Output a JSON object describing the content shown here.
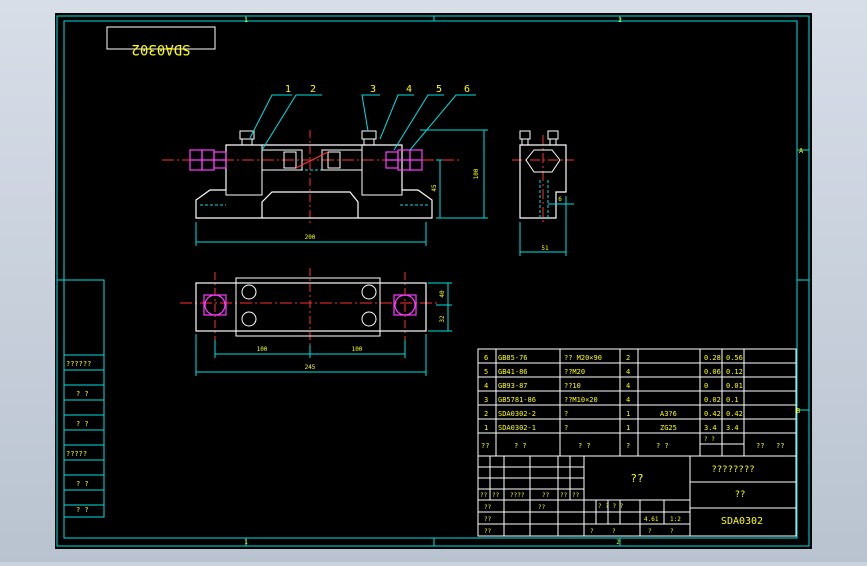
{
  "drawing": {
    "number_mirrored": "SDA0302",
    "number": "SDA0302",
    "grid_top": [
      "1",
      "2"
    ],
    "grid_bottom": [
      "1",
      "2"
    ],
    "grid_side": [
      "A",
      "B"
    ],
    "balloons": [
      "1",
      "2",
      "3",
      "4",
      "5",
      "6"
    ],
    "dims": {
      "front_width": "200",
      "front_height": "100",
      "front_mid": "45",
      "side_width": "51",
      "side_small": "6",
      "top_half_left": "100",
      "top_half_right": "100",
      "top_total": "245",
      "top_h1": "40",
      "top_h2": "32"
    }
  },
  "bom": {
    "rows": [
      {
        "no": "6",
        "code": "GB85-76",
        "name": "?? M20×90",
        "qty": "2",
        "mat": "",
        "w1": "0.28",
        "w2": "0.56"
      },
      {
        "no": "5",
        "code": "GB41-86",
        "name": "??M20",
        "qty": "4",
        "mat": "",
        "w1": "0.06",
        "w2": "0.12"
      },
      {
        "no": "4",
        "code": "GB93-87",
        "name": "??10",
        "qty": "4",
        "mat": "",
        "w1": "0",
        "w2": "0.01"
      },
      {
        "no": "3",
        "code": "GB5781-86",
        "name": "??M10×20",
        "qty": "4",
        "mat": "",
        "w1": "0.02",
        "w2": "0.1"
      },
      {
        "no": "2",
        "code": "SDA0302-2",
        "name": "?",
        "qty": "1",
        "mat": "A3?6",
        "w1": "0.42",
        "w2": "0.42"
      },
      {
        "no": "1",
        "code": "SDA0302-1",
        "name": "?",
        "qty": "1",
        "mat": "ZG25",
        "w1": "3.4",
        "w2": "3.4"
      }
    ],
    "header": [
      "??",
      "?    ?",
      "?    ?",
      "?",
      "?    ?",
      "? ?",
      "??",
      "??"
    ]
  },
  "left_table": {
    "labels": [
      "??????",
      "?  ?",
      "?  ?",
      "?????",
      "?  ?",
      "?  ?"
    ]
  },
  "title_block": {
    "name": "??",
    "company": "????????",
    "material": "??",
    "code": "SDA0302",
    "sign_row": [
      "??",
      "??",
      "????",
      "??",
      "??",
      "??"
    ],
    "row_design": "??",
    "row_review": "??",
    "row_process": "??",
    "row_approve": "??",
    "stage_label": "? ? ? ?",
    "weight": "4.61",
    "scale": "1:2",
    "sheet": [
      "?",
      "?",
      "?",
      "?"
    ]
  }
}
